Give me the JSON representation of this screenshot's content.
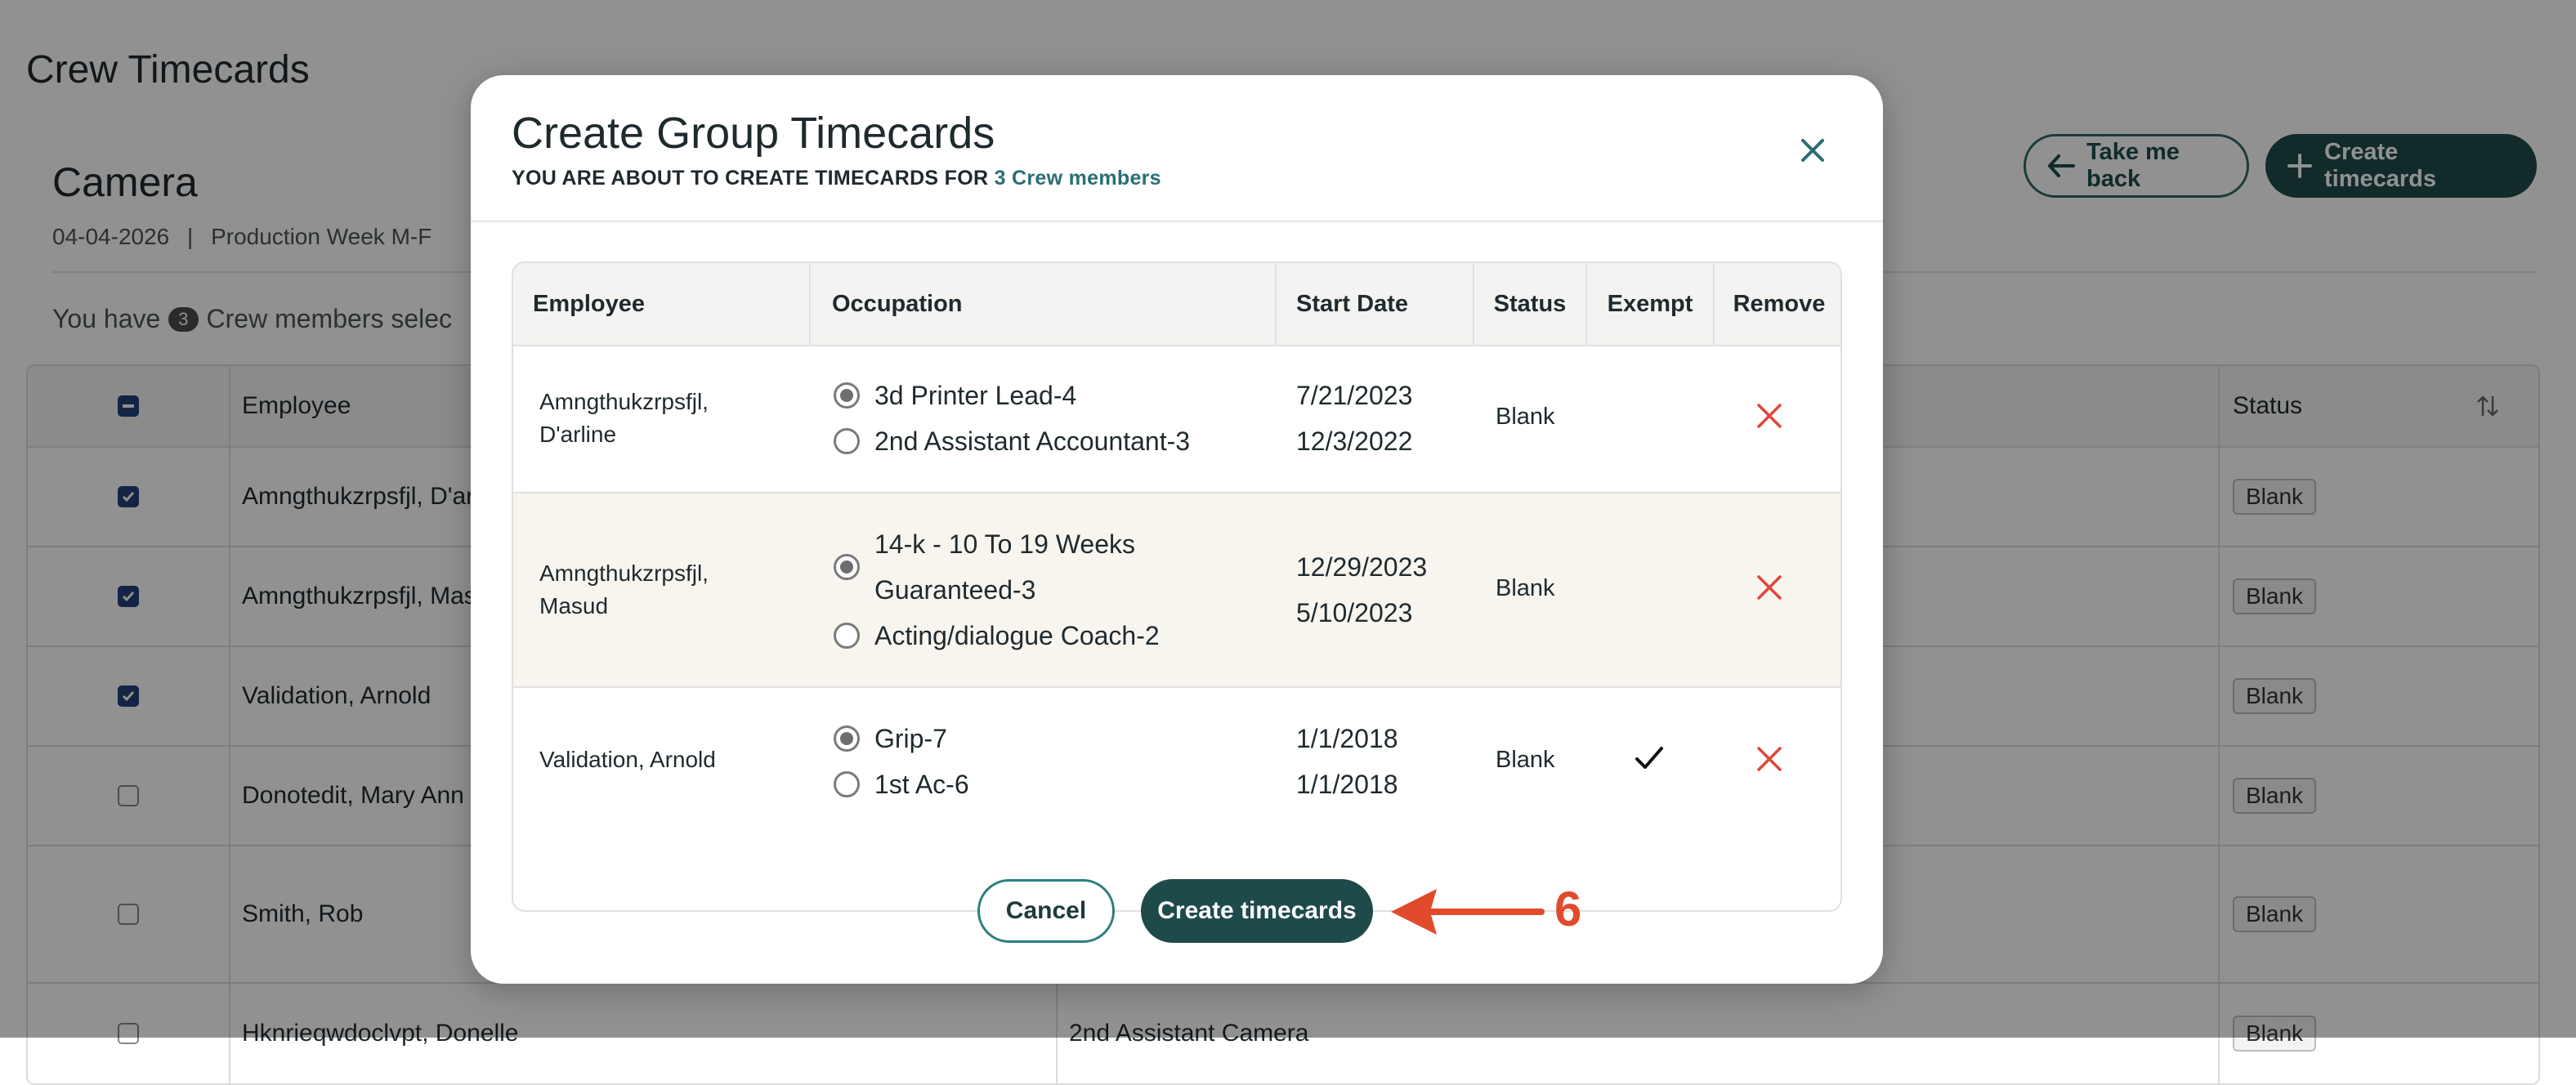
{
  "page": {
    "title": "Crew Timecards",
    "section_title": "Camera",
    "date": "04-04-2026",
    "separator": "|",
    "week": "Production Week M-F",
    "selection_prefix": "You have",
    "selection_count": "3",
    "selection_suffix": "Crew members selec",
    "take_me_back_label": "Take me back",
    "create_timecards_label": "Create timecards"
  },
  "bg_table": {
    "headers": {
      "employee": "Employee",
      "status": "Status"
    },
    "rows": [
      {
        "name": "Amngthukzrpsfjl, D'ar",
        "occupation": "",
        "status": "Blank",
        "checked": true
      },
      {
        "name": "Amngthukzrpsfjl, Mas",
        "occupation": "",
        "status": "Blank",
        "checked": true
      },
      {
        "name": "Validation, Arnold",
        "occupation": "",
        "status": "Blank",
        "checked": true
      },
      {
        "name": "Donotedit, Mary Ann",
        "occupation": "",
        "status": "Blank",
        "checked": false
      },
      {
        "name": "Smith, Rob",
        "occupation": "",
        "status": "Blank",
        "checked": false
      },
      {
        "name": "Hknrieqwdoclvpt, Donelle",
        "occupation": "2nd Assistant Camera",
        "status": "Blank",
        "checked": false
      }
    ]
  },
  "modal": {
    "title": "Create Group Timecards",
    "subtitle_prefix": "YOU ARE ABOUT TO CREATE TIMECARDS FOR",
    "subtitle_accent": "3 Crew members",
    "columns": {
      "employee": "Employee",
      "occupation": "Occupation",
      "start_date": "Start Date",
      "status": "Status",
      "exempt": "Exempt",
      "remove": "Remove"
    },
    "rows": [
      {
        "employee_line1": "Amngthukzrpsfjl,",
        "employee_line2": "D'arline",
        "occ1": "3d Printer Lead-4",
        "occ1_line2": "",
        "occ2": "2nd Assistant Accountant-3",
        "date1": "7/21/2023",
        "date2": "12/3/2022",
        "status": "Blank",
        "exempt": "",
        "exempt_checked": false
      },
      {
        "employee_line1": "Amngthukzrpsfjl,",
        "employee_line2": "Masud",
        "occ1": "14-k - 10 To 19 Weeks",
        "occ1_line2": "Guaranteed-3",
        "occ2": "Acting/dialogue Coach-2",
        "date1": "12/29/2023",
        "date2": "5/10/2023",
        "status": "Blank",
        "exempt": "",
        "exempt_checked": false
      },
      {
        "employee_line1": "Validation, Arnold",
        "employee_line2": "",
        "occ1": "Grip-7",
        "occ1_line2": "",
        "occ2": "1st Ac-6",
        "date1": "1/1/2018",
        "date2": "1/1/2018",
        "status": "Blank",
        "exempt": "",
        "exempt_checked": true
      }
    ],
    "cancel_label": "Cancel",
    "create_label": "Create timecards"
  },
  "annotation": {
    "number": "6",
    "color": "#e24a2c"
  },
  "colors": {
    "brand_dark": "#1f4a4a",
    "accent_teal": "#2a6e74",
    "remove_red": "#e0453a",
    "checkbox_blue": "#23407a"
  },
  "icons": {
    "close": "close-icon",
    "remove": "remove-x-icon",
    "exempt": "checkmark-icon",
    "back": "arrow-left-icon",
    "plus": "plus-icon",
    "sort": "sort-icon"
  }
}
